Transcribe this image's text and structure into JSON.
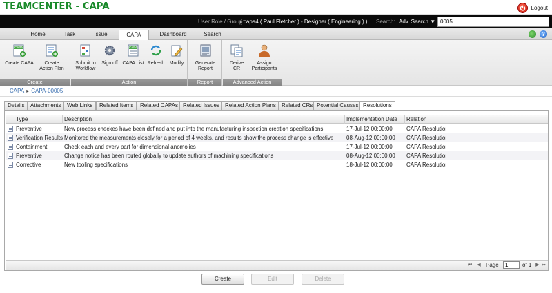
{
  "app": {
    "title": "TEAMCENTER - CAPA",
    "logout_label": "Logout"
  },
  "userbar": {
    "role_label": "User Role / Group:",
    "role_value": "( capa4 ( Paul Fletcher ) - Designer ( Engineering ) )",
    "search_label": "Search:",
    "adv_search_label": "Adv. Search ▼",
    "search_value": "0005"
  },
  "menu_tabs": [
    {
      "label": "Home"
    },
    {
      "label": "Task"
    },
    {
      "label": "Issue"
    },
    {
      "label": "CAPA"
    },
    {
      "label": "Dashboard"
    },
    {
      "label": "Search"
    }
  ],
  "active_menu_tab": "CAPA",
  "ribbon": {
    "groups": [
      {
        "label": "Create",
        "buttons": [
          "Create CAPA",
          "Create Action Plan"
        ]
      },
      {
        "label": "Action",
        "buttons": [
          "Submit to Workflow",
          "Sign off",
          "CAPA List",
          "Refresh",
          "Modify"
        ]
      },
      {
        "label": "Report",
        "buttons": [
          "Generate Report"
        ]
      },
      {
        "label": "Advanced Action",
        "buttons": [
          "Derive CR",
          "Assign Participants"
        ]
      }
    ]
  },
  "breadcrumb": {
    "root": "CAPA",
    "current": "CAPA-00005"
  },
  "sub_tabs": [
    {
      "label": "Details"
    },
    {
      "label": "Attachments"
    },
    {
      "label": "Web Links"
    },
    {
      "label": "Related Items"
    },
    {
      "label": "Related CAPAs"
    },
    {
      "label": "Related Issues"
    },
    {
      "label": "Related Action Plans"
    },
    {
      "label": "Related CRs"
    },
    {
      "label": "Potential Causes"
    },
    {
      "label": "Resolutions"
    }
  ],
  "active_sub_tab": "Resolutions",
  "grid": {
    "columns": [
      "Type",
      "Description",
      "Implementation Date",
      "Relation"
    ],
    "rows": [
      {
        "type": "Preventive",
        "description": "New process checkes have been defined and put into the manufacturing inspection creation specifications",
        "date": "17-Jul-12 00:00:00",
        "relation": "CAPA Resolution"
      },
      {
        "type": "Verification Results",
        "description": "Monitored the measurements closely for a period of 4 weeks, and results show the process change is effective",
        "date": "08-Aug-12 00:00:00",
        "relation": "CAPA Resolution"
      },
      {
        "type": "Containment",
        "description": "Check each and every part for dimensional anomolies",
        "date": "17-Jul-12 00:00:00",
        "relation": "CAPA Resolution"
      },
      {
        "type": "Preventive",
        "description": "Change notice has been routed globally to update authors of machining specifications",
        "date": "08-Aug-12 00:00:00",
        "relation": "CAPA Resolution"
      },
      {
        "type": "Corrective",
        "description": "New tooling specifications",
        "date": "18-Jul-12 00:00:00",
        "relation": "CAPA Resolution"
      }
    ]
  },
  "pager": {
    "page_label": "Page",
    "page_value": "1",
    "of_label": "of 1"
  },
  "actions": {
    "create": "Create",
    "edit": "Edit",
    "delete": "Delete"
  }
}
